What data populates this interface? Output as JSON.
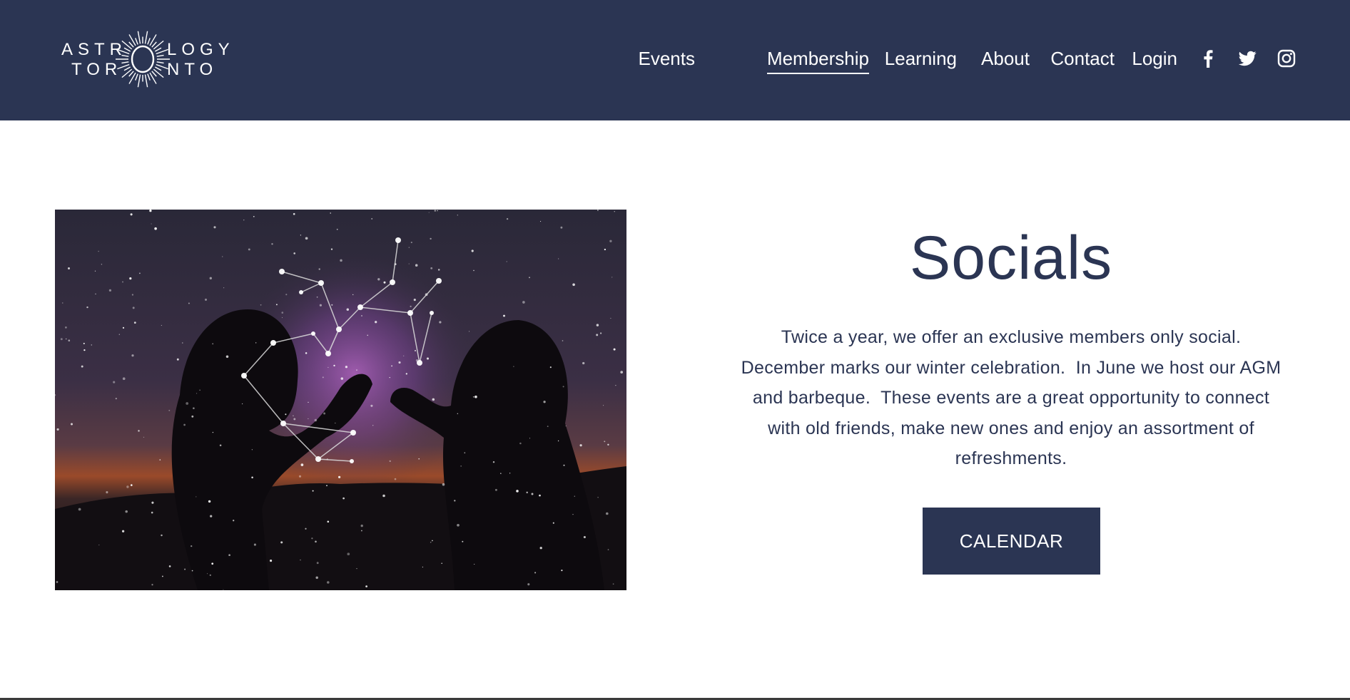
{
  "header": {
    "logo": {
      "line1_left": "ASTR",
      "line1_right": "LOGY",
      "line2_left": "TOR",
      "line2_right": "NTO"
    },
    "nav": [
      {
        "label": "Events"
      },
      {
        "label": "Membership",
        "active": true
      },
      {
        "label": "Learning"
      },
      {
        "label": "About"
      },
      {
        "label": "Contact"
      },
      {
        "label": "Login"
      }
    ],
    "social": [
      "facebook-icon",
      "twitter-icon",
      "instagram-icon"
    ]
  },
  "main": {
    "image_alt": "Two silhouettes forming a heart shape with hands under a starry night sky with a constellation",
    "title": "Socials",
    "description_lines": [
      "Twice a year, we offer an exclusive members only social.",
      "December marks our winter celebration.  In June we host our AGM",
      "and barbeque.  These events are a great opportunity to connect",
      "with old friends, make new ones and enjoy an assortment of",
      "refreshments."
    ],
    "cta_label": "CALENDAR"
  },
  "colors": {
    "brand": "#2b3553",
    "background": "#ffffff",
    "text_on_brand": "#ffffff"
  }
}
